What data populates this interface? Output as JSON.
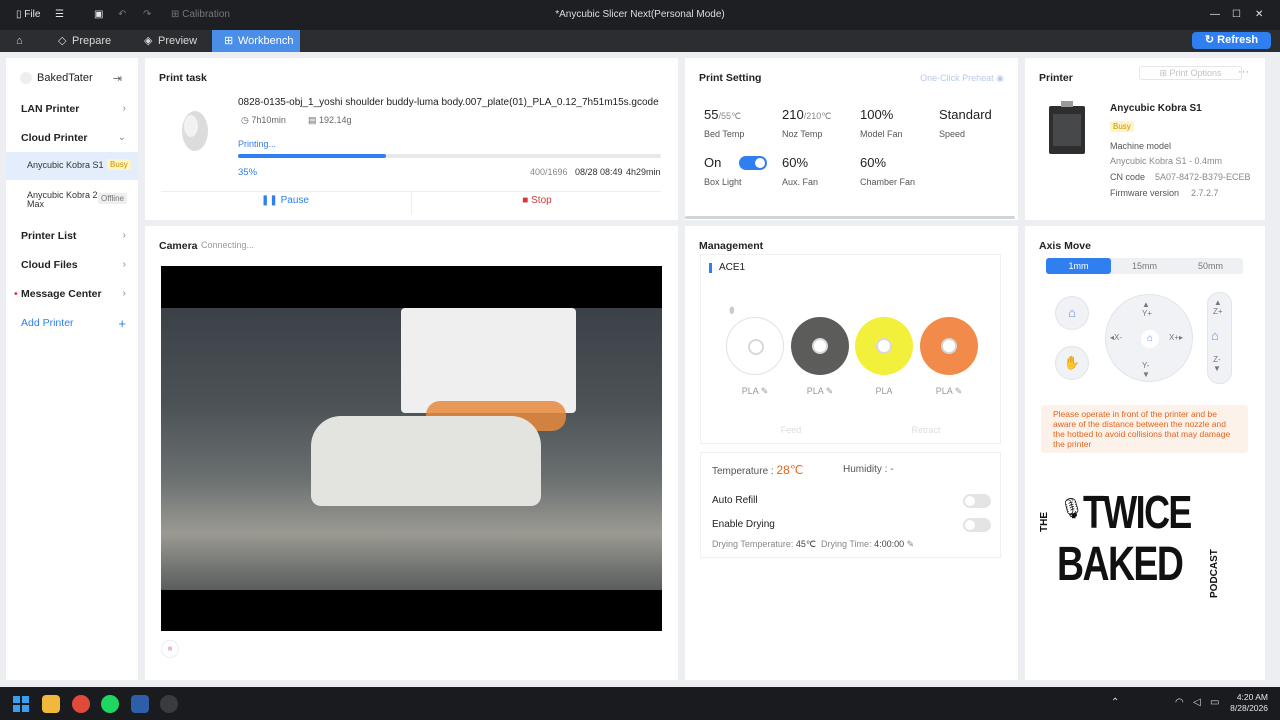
{
  "titlebar": {
    "file_label": "File",
    "calibration_label": "Calibration",
    "window_title": "*Anycubic Slicer Next(Personal Mode)"
  },
  "nav": {
    "tabs": [
      "Prepare",
      "Preview",
      "Workbench"
    ],
    "active_tab": "Workbench",
    "refresh_label": "Refresh"
  },
  "sidebar": {
    "user": "BakedTater",
    "lan_printer": "LAN Printer",
    "cloud_printer": "Cloud Printer",
    "printers": [
      {
        "name": "Anycubic Kobra S1",
        "status": "Busy"
      },
      {
        "name": "Anycubic Kobra 2 Max",
        "status": "Offline"
      }
    ],
    "printer_list": "Printer List",
    "cloud_files": "Cloud Files",
    "message_center": "Message Center",
    "add_printer": "Add Printer"
  },
  "print_task": {
    "title": "Print task",
    "filename": "0828-0135-obj_1_yoshi shoulder buddy-luma body.007_plate(01)_PLA_0.12_7h51m15s.gcode",
    "duration": "7h10min",
    "weight": "192.14g",
    "status": "Printing...",
    "progress_pct": 35,
    "progress_text": "35%",
    "layers": "400/1696",
    "date": "08/28 08:49",
    "remaining": "4h29min",
    "pause_label": "Pause",
    "stop_label": "Stop"
  },
  "print_setting": {
    "title": "Print Setting",
    "preheat_label": "One-Click Preheat",
    "bed_temp": "55",
    "bed_target": "/55℃",
    "bed_label": "Bed Temp",
    "noz_temp": "210",
    "noz_target": "/210℃",
    "noz_label": "Noz Temp",
    "model_fan": "100%",
    "model_fan_label": "Model Fan",
    "speed": "Standard",
    "speed_label": "Speed",
    "box_light": "On",
    "box_light_label": "Box Light",
    "aux_fan": "60%",
    "aux_fan_label": "Aux. Fan",
    "chamber_fan": "60%",
    "chamber_fan_label": "Chamber Fan"
  },
  "printer": {
    "title": "Printer",
    "options_label": "Print Options",
    "name": "Anycubic Kobra S1",
    "status": "Busy",
    "machine_model_label": "Machine model",
    "machine_model": "Anycubic Kobra S1 - 0.4mm",
    "cn_label": "CN code",
    "cn_code": "5A07-8472-B379-ECEB",
    "firmware_label": "Firmware version",
    "firmware": "2.7.2.7"
  },
  "camera": {
    "title": "Camera",
    "status": "Connecting..."
  },
  "management": {
    "title": "Management",
    "unit": "ACE1",
    "slots": [
      {
        "material": "PLA",
        "color": "#ffffff"
      },
      {
        "material": "PLA",
        "color": "#5c5d5a"
      },
      {
        "material": "PLA",
        "color": "#f2f03a"
      },
      {
        "material": "PLA",
        "color": "#f28a4a"
      }
    ],
    "feed_label": "Feed",
    "retract_label": "Retract",
    "temperature_label": "Temperature :",
    "temperature": "28℃",
    "humidity_label": "Humidity :",
    "humidity": "-",
    "auto_refill_label": "Auto Refill",
    "enable_drying_label": "Enable Drying",
    "drying_temp_label": "Drying Temperature:",
    "drying_temp": "45℃",
    "drying_time_label": "Drying Time:",
    "drying_time": "4:00:00"
  },
  "axis": {
    "title": "Axis Move",
    "steps": [
      "1mm",
      "15mm",
      "50mm"
    ],
    "active_step": "1mm",
    "y_plus": "Y+",
    "y_minus": "Y-",
    "x_plus": "X+",
    "x_minus": "X-",
    "z_plus": "Z+",
    "z_minus": "Z-",
    "warning": "Please operate in front of the printer and be aware of the distance between the nozzle and the hotbed to avoid collisions that may damage the printer"
  },
  "logo": {
    "line1": "THE",
    "line2": "TWICE",
    "line3": "BAKED",
    "line4": "PODCAST"
  },
  "taskbar": {
    "time": "4:20 AM",
    "date": "8/28/2026"
  }
}
